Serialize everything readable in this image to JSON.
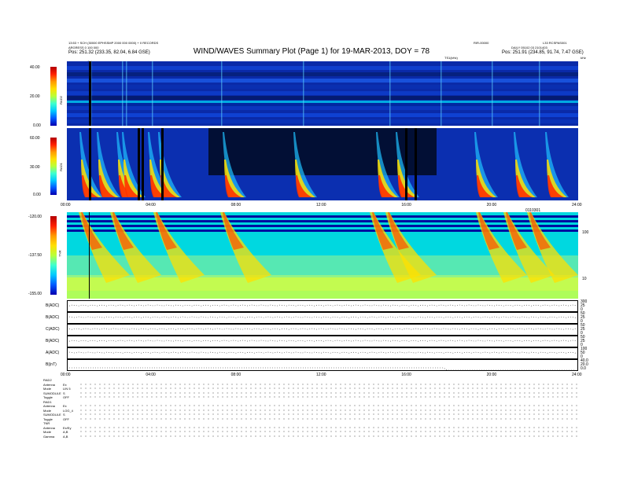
{
  "header": {
    "title": "WIND/WAVES Summary Plot (Page 1) for 19-MAR-2013, DOY = 78",
    "left_line1": "13:53 + SCH (30000 EPHSSMP 2000 000 0000) + 0 RECORDS",
    "left_line2": "ARGRESS 0 100 000",
    "left_pos": "Pos:  251.32 (233.35, 82.04, 6.84 GSE)",
    "right_top": "RIR-00000",
    "right_top2": "L33 RCSPAS001",
    "right_line": "DAILY  05102 03 2101403",
    "right_pos": "Pos:  251.91 (234.85, 91.74, 7.47 GSE)",
    "time_label": "TS1(kHz)",
    "freq_unit": "kHz",
    "cal_label": "Cal"
  },
  "chart_data": [
    {
      "type": "heatmap",
      "panel": "RAD2",
      "ylabel": "RAD2",
      "ytick_labels": [
        "40.00",
        "20.00",
        "0.00"
      ]
    },
    {
      "type": "heatmap",
      "panel": "RAD1",
      "ylabel": "RAD1",
      "ytick_labels": [
        "60.00",
        "30.00",
        "0.00"
      ],
      "x_tick_labels": [
        "00:00",
        "04:00",
        "08:00",
        "12:00",
        "16:00",
        "20:00",
        "24:00"
      ],
      "x_end_label": "0110301"
    },
    {
      "type": "heatmap",
      "panel": "TNR",
      "ylabel": "TNR",
      "ytick_labels": [
        "-120.00",
        "-137.50",
        "-155.00"
      ],
      "right_tick_labels": [
        "100",
        "10"
      ]
    },
    {
      "type": "line",
      "panels": [
        {
          "label": "B(ADC)",
          "right": [
            "300",
            "25",
            "0"
          ]
        },
        {
          "label": "B(ADC)",
          "right": [
            "50",
            "25",
            "0"
          ]
        },
        {
          "label": "C(ADC)",
          "right": [
            "50",
            "25",
            "0"
          ]
        },
        {
          "label": "B(ADC)",
          "right": [
            "50",
            "25",
            "0"
          ]
        },
        {
          "label": "A(ADC)",
          "right": [
            "100",
            "50",
            "0"
          ]
        },
        {
          "label": "B|(nT)",
          "right": [
            "40.0",
            "20.0",
            "0.0"
          ]
        }
      ],
      "x_tick_labels": [
        "00:00",
        "04:00",
        "08:00",
        "12:00",
        "16:00",
        "20:00",
        "24:00"
      ]
    }
  ],
  "footer": {
    "rad2_header": "RAD2",
    "rad2_rows": [
      "Antenna",
      "Mode",
      "SUMODULE",
      "Toggle"
    ],
    "rad2_vals": [
      "Ex",
      "LIN 5",
      "S",
      "OFF"
    ],
    "rad1_header": "RAD1",
    "rad1_rows": [
      "Antenna",
      "Mode",
      "SUMODULE",
      "Toggle"
    ],
    "rad1_vals": [
      "Ex",
      "LOG_4",
      "S",
      "OFF"
    ],
    "tnr_header": "TNR",
    "tnr_rows": [
      "Antenna",
      "Mode",
      "Gamma"
    ],
    "tnr_vals": [
      "Ex/Ey",
      "A,B",
      "A,B"
    ]
  }
}
